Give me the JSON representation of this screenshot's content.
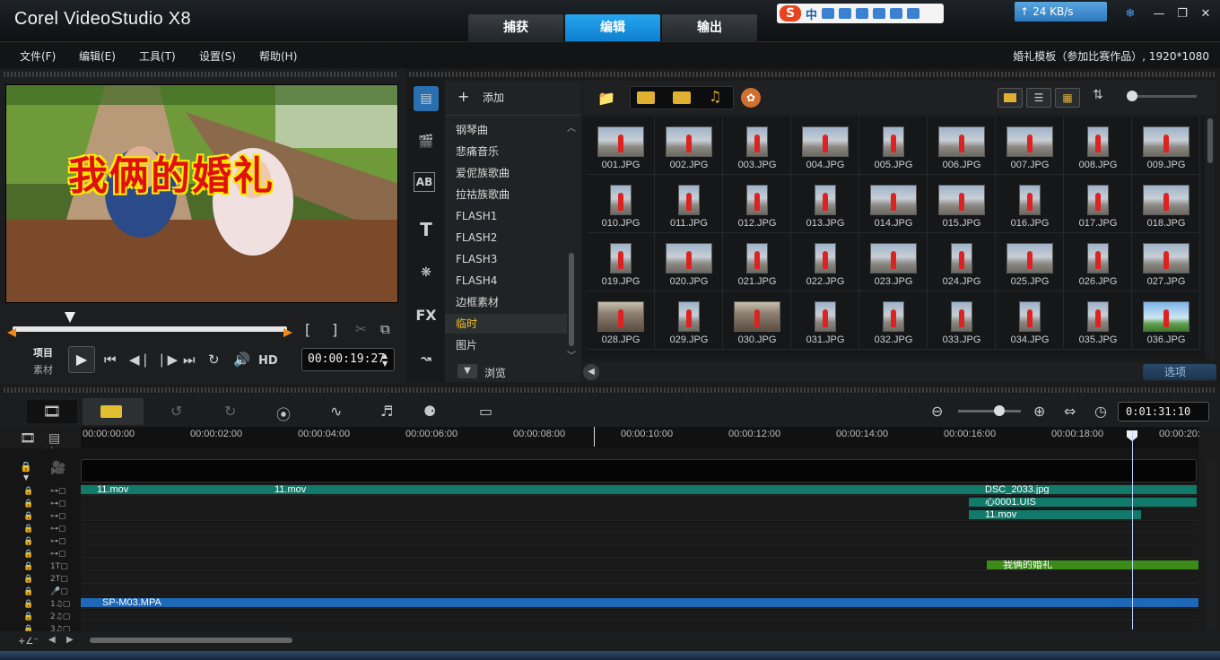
{
  "app": {
    "title": "Corel VideoStudio X8"
  },
  "main_tabs": [
    {
      "label": "捕获",
      "active": false
    },
    {
      "label": "编辑",
      "active": true
    },
    {
      "label": "输出",
      "active": false
    }
  ],
  "ime": {
    "logo": "S",
    "mode": "中"
  },
  "network": {
    "speed": "24 KB/s"
  },
  "menu": [
    "文件(F)",
    "编辑(E)",
    "工具(T)",
    "设置(S)",
    "帮助(H)"
  ],
  "project_title": "婚礼模板（参加比赛作品）, 1920*1080",
  "preview": {
    "overlay_text": "我俩的婚礼",
    "mode_project": "项目",
    "mode_clip": "素材",
    "hd_label": "HD",
    "timecode": "00:00:19:27"
  },
  "library": {
    "add_label": "添加",
    "browse_label": "浏览",
    "footer_option": "选项",
    "folders": [
      "钢琴曲",
      "悲痛音乐",
      "爱伲族歌曲",
      "拉祜族歌曲",
      "FLASH1",
      "FLASH2",
      "FLASH3",
      "FLASH4",
      "边框素材",
      "临时",
      "图片"
    ],
    "selected_folder": "临时",
    "thumbnails": [
      {
        "name": "001.JPG",
        "shape": "landscape"
      },
      {
        "name": "002.JPG",
        "shape": "landscape"
      },
      {
        "name": "003.JPG",
        "shape": "portrait"
      },
      {
        "name": "004.JPG",
        "shape": "landscape"
      },
      {
        "name": "005.JPG",
        "shape": "portrait"
      },
      {
        "name": "006.JPG",
        "shape": "landscape"
      },
      {
        "name": "007.JPG",
        "shape": "landscape"
      },
      {
        "name": "008.JPG",
        "shape": "portrait"
      },
      {
        "name": "009.JPG",
        "shape": "landscape"
      },
      {
        "name": "010.JPG",
        "shape": "portrait"
      },
      {
        "name": "011.JPG",
        "shape": "portrait"
      },
      {
        "name": "012.JPG",
        "shape": "portrait"
      },
      {
        "name": "013.JPG",
        "shape": "portrait"
      },
      {
        "name": "014.JPG",
        "shape": "landscape"
      },
      {
        "name": "015.JPG",
        "shape": "landscape"
      },
      {
        "name": "016.JPG",
        "shape": "portrait"
      },
      {
        "name": "017.JPG",
        "shape": "portrait"
      },
      {
        "name": "018.JPG",
        "shape": "landscape"
      },
      {
        "name": "019.JPG",
        "shape": "portrait"
      },
      {
        "name": "020.JPG",
        "shape": "landscape"
      },
      {
        "name": "021.JPG",
        "shape": "portrait"
      },
      {
        "name": "022.JPG",
        "shape": "portrait"
      },
      {
        "name": "023.JPG",
        "shape": "landscape"
      },
      {
        "name": "024.JPG",
        "shape": "portrait"
      },
      {
        "name": "025.JPG",
        "shape": "landscape"
      },
      {
        "name": "026.JPG",
        "shape": "portrait"
      },
      {
        "name": "027.JPG",
        "shape": "landscape"
      },
      {
        "name": "028.JPG",
        "shape": "landscape"
      },
      {
        "name": "029.JPG",
        "shape": "portrait"
      },
      {
        "name": "030.JPG",
        "shape": "landscape"
      },
      {
        "name": "031.JPG",
        "shape": "portrait"
      },
      {
        "name": "032.JPG",
        "shape": "portrait"
      },
      {
        "name": "033.JPG",
        "shape": "portrait"
      },
      {
        "name": "034.JPG",
        "shape": "portrait"
      },
      {
        "name": "035.JPG",
        "shape": "portrait"
      },
      {
        "name": "036.JPG",
        "shape": "landscape"
      }
    ]
  },
  "timeline": {
    "total_time": "0:01:31:10",
    "ticks": [
      "00:00:00:00",
      "00:00:02:00",
      "00:00:04:00",
      "00:00:06:00",
      "00:00:08:00",
      "00:00:10:00",
      "00:00:12:00",
      "00:00:14:00",
      "00:00:16:00",
      "00:00:18:00",
      "00:00:20:"
    ],
    "clips": {
      "video1": "11.mov",
      "video2": "11.mov",
      "overlay1": "DSC_2033.jpg",
      "overlay2": "心0001.UIS",
      "overlay3": "11.mov",
      "title": "我俩的婚礼",
      "music": "SP-M03.MPA"
    }
  },
  "colors": {
    "accent": "#1592e0",
    "clip_teal": "#127a6a",
    "clip_green": "#3c8c1a",
    "clip_blue": "#1e68b8"
  }
}
